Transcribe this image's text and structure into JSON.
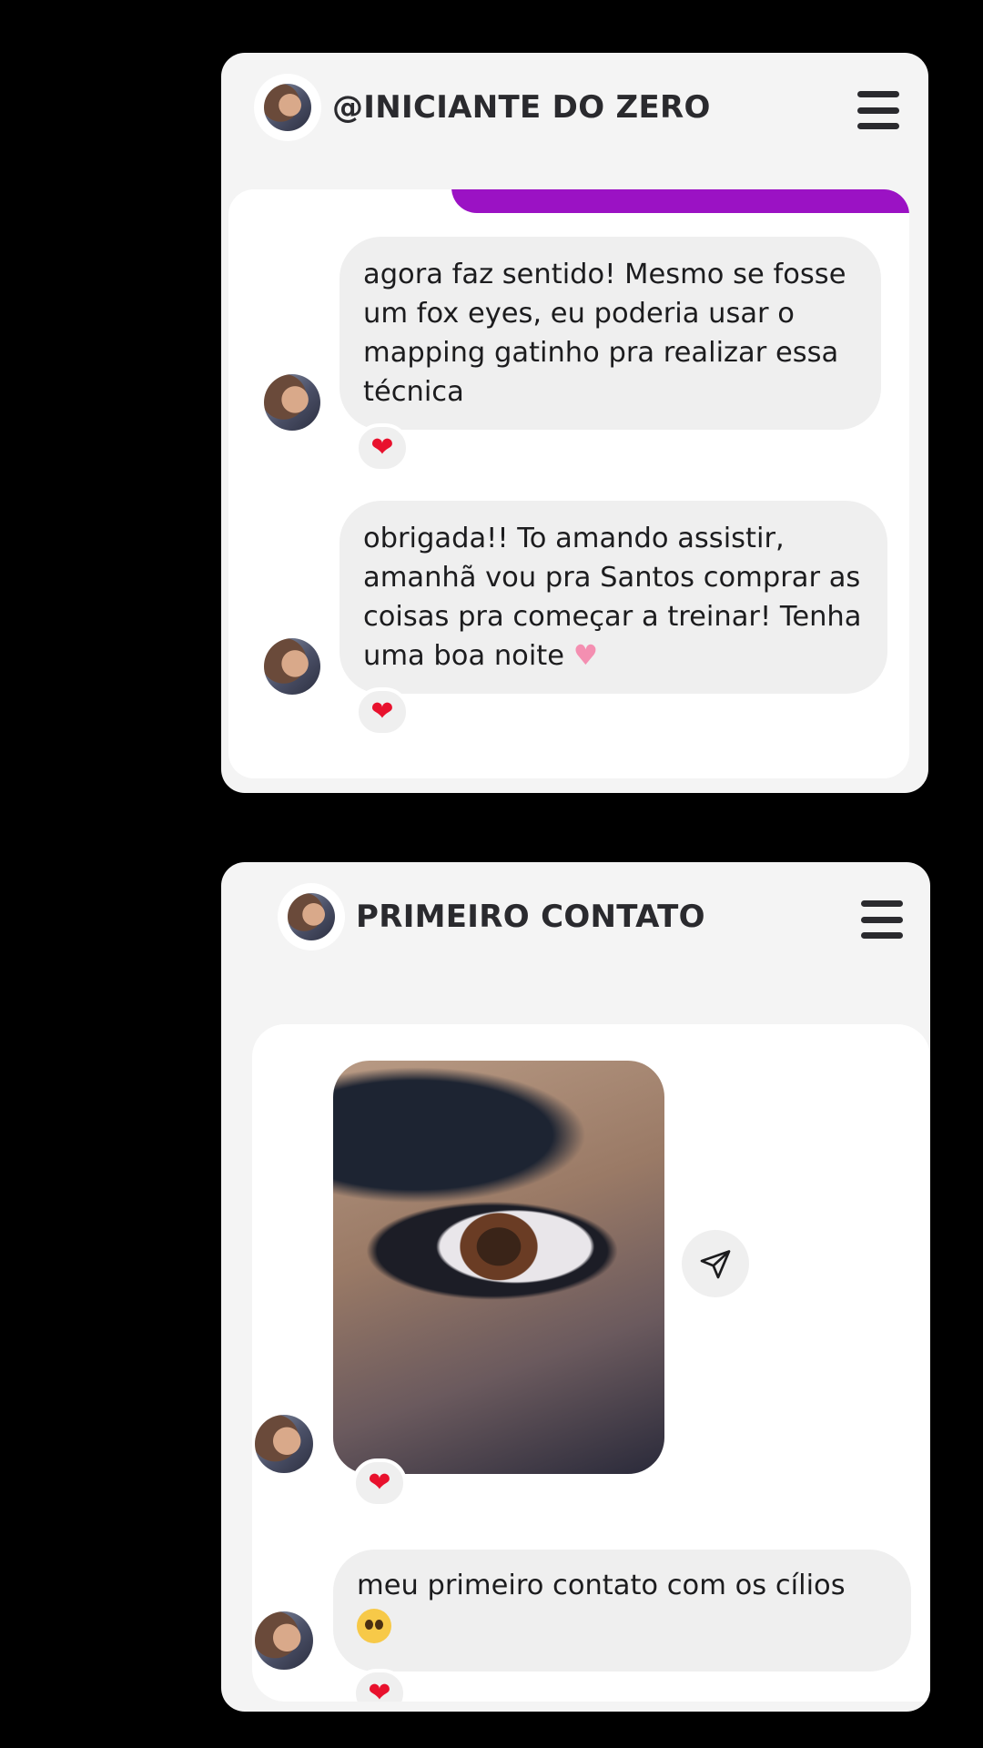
{
  "cards": [
    {
      "title": "@INICIANTE DO ZERO",
      "messages": [
        {
          "text": "agora faz sentido! Mesmo se fosse um fox eyes, eu poderia usar o mapping gatinho pra realizar essa técnica",
          "reaction": "❤"
        },
        {
          "text": "obrigada!! To amando assistir, amanhã vou pra Santos comprar as coisas pra começar a treinar! Tenha uma boa noite ",
          "emoji": "♥",
          "reaction": "❤"
        }
      ]
    },
    {
      "title": "PRIMEIRO CONTATO",
      "photo": {
        "reaction": "❤"
      },
      "messages": [
        {
          "text": "meu primeiro contato com os cílios",
          "emoji_icon": "pleading-face-emoji",
          "reaction": "❤"
        }
      ]
    }
  ],
  "colors": {
    "background": "#000000",
    "card": "#f4f4f4",
    "bubble_received": "#efefef",
    "bubble_sent": "#9b12c4",
    "reaction_heart": "#e8112d"
  },
  "icons": {
    "menu": "hamburger-menu-icon",
    "forward": "paper-plane-icon"
  }
}
